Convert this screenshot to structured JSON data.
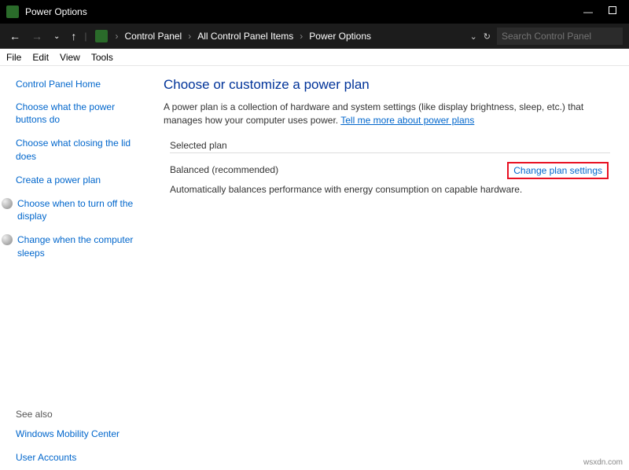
{
  "titlebar": {
    "title": "Power Options"
  },
  "breadcrumb": {
    "items": [
      "Control Panel",
      "All Control Panel Items",
      "Power Options"
    ]
  },
  "search": {
    "placeholder": "Search Control Panel"
  },
  "menubar": {
    "items": [
      "File",
      "Edit",
      "View",
      "Tools"
    ]
  },
  "sidebar": {
    "home": "Control Panel Home",
    "links": [
      "Choose what the power buttons do",
      "Choose what closing the lid does",
      "Create a power plan",
      "Choose when to turn off the display",
      "Change when the computer sleeps"
    ],
    "see_also_label": "See also",
    "see_also_links": [
      "Windows Mobility Center",
      "User Accounts"
    ]
  },
  "main": {
    "title": "Choose or customize a power plan",
    "description": "A power plan is a collection of hardware and system settings (like display brightness, sleep, etc.) that manages how your computer uses power. ",
    "tell_more": "Tell me more about power plans",
    "section_head": "Selected plan",
    "plan_name": "Balanced (recommended)",
    "change_link": "Change plan settings",
    "plan_desc": "Automatically balances performance with energy consumption on capable hardware."
  },
  "watermark": "wsxdn.com"
}
